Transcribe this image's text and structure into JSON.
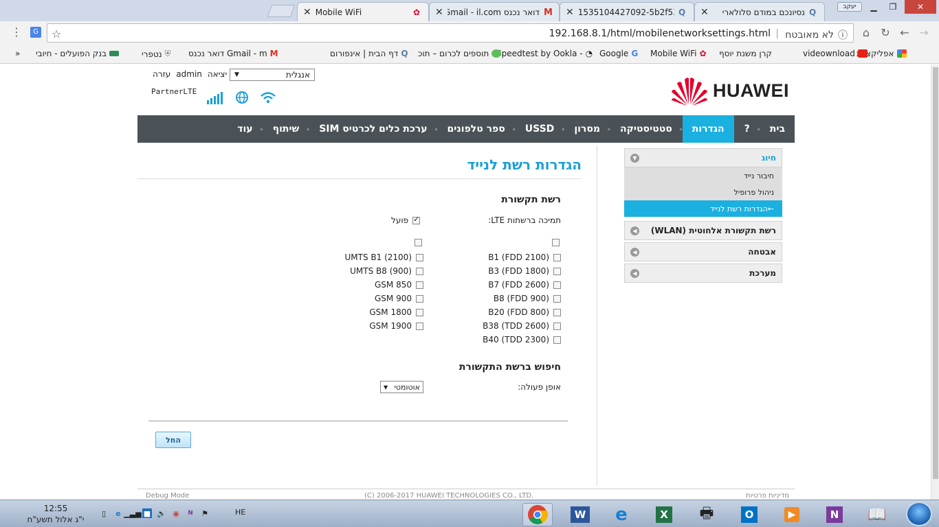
{
  "browser": {
    "tabs": [
      {
        "title": "Mobile WiFi"
      },
      {
        "title": "דואר נכנס Gmail - il.com"
      },
      {
        "title": "1535104427092-5b2f539"
      },
      {
        "title": "נסיונכם במודם סלולארי"
      }
    ],
    "profile_label": "יעקב",
    "address": {
      "url": "192.168.8.1/html/mobilenetworksettings.html",
      "security_text": "לא מאובטח"
    },
    "bookmarks": [
      {
        "label": "אפליקציות"
      },
      {
        "label": "videownload"
      },
      {
        "label": "קרן משנת יוסף"
      },
      {
        "label": "Mobile WiFi"
      },
      {
        "label": "Google"
      },
      {
        "label": "Speedtest by Ookla -"
      },
      {
        "label": "תוספים לכרום – תוכ"
      },
      {
        "label": "דף הבית | אינפורום"
      },
      {
        "label": "דואר נכנס Gmail - m"
      },
      {
        "label": "נטפרי"
      },
      {
        "label": "בנק הפועלים - חיובי"
      },
      {
        "label": "»"
      }
    ]
  },
  "header": {
    "logout": "יציאה",
    "user": "admin",
    "help": "עזרה",
    "language": "אנגלית",
    "operator": "PartnerLTE",
    "brand": "HUAWEI"
  },
  "nav": {
    "items": [
      {
        "label": "בית",
        "active": false
      },
      {
        "label": "?",
        "active": false
      },
      {
        "label": "הגדרות",
        "active": true
      },
      {
        "label": "סטטיסטיקה",
        "active": false
      },
      {
        "label": "מסרון",
        "active": false
      },
      {
        "label": "USSD",
        "active": false
      },
      {
        "label": "ספר טלפונים",
        "active": false
      },
      {
        "label": "ערכת כלים לכרטיס SIM",
        "active": false
      },
      {
        "label": "שיתוף",
        "active": false
      },
      {
        "label": "עוד",
        "active": false
      }
    ]
  },
  "sidebar": {
    "dialup": {
      "label": "חיוג",
      "items": [
        {
          "label": "חיבור נייד"
        },
        {
          "label": "ניהול פרופיל"
        },
        {
          "label": "←הגדרות רשת לנייד"
        }
      ]
    },
    "groups": [
      {
        "label": "רשת תקשורת אלחוטית (WLAN)"
      },
      {
        "label": "אבטחה"
      },
      {
        "label": "מערכת"
      }
    ]
  },
  "content": {
    "title": "הגדרות רשת לנייד",
    "network_section": "רשת תקשורת",
    "lte_support_label": "תמיכה ברשתות LTE:",
    "lte_enabled_label": "פועל",
    "lte_bands": [
      "B1 (FDD 2100)",
      "B3 (FDD 1800)",
      "B7 (FDD 2600)",
      "B8 (FDD 900)",
      "B20 (FDD 800)",
      "B38 (TDD 2600)",
      "B40 (TDD 2300)"
    ],
    "other_bands": [
      "UMTS B1 (2100)",
      "UMTS B8 (900)",
      "GSM 850",
      "GSM 900",
      "GSM 1800",
      "GSM 1900"
    ],
    "search_section": "חיפוש ברשת התקשורת",
    "mode_label": "אופן פעולה:",
    "mode_value": "אוטומטי",
    "apply": "החל",
    "footer_left": "Debug Mode",
    "footer_center": "(C) 2006-2017 HUAWEI TECHNOLOGIES CO., LTD.",
    "footer_right": "מדיניות פרטיות"
  },
  "taskbar": {
    "time": "12:55",
    "date": "י\"ג אלול תשע\"ח",
    "lang": "HE"
  }
}
